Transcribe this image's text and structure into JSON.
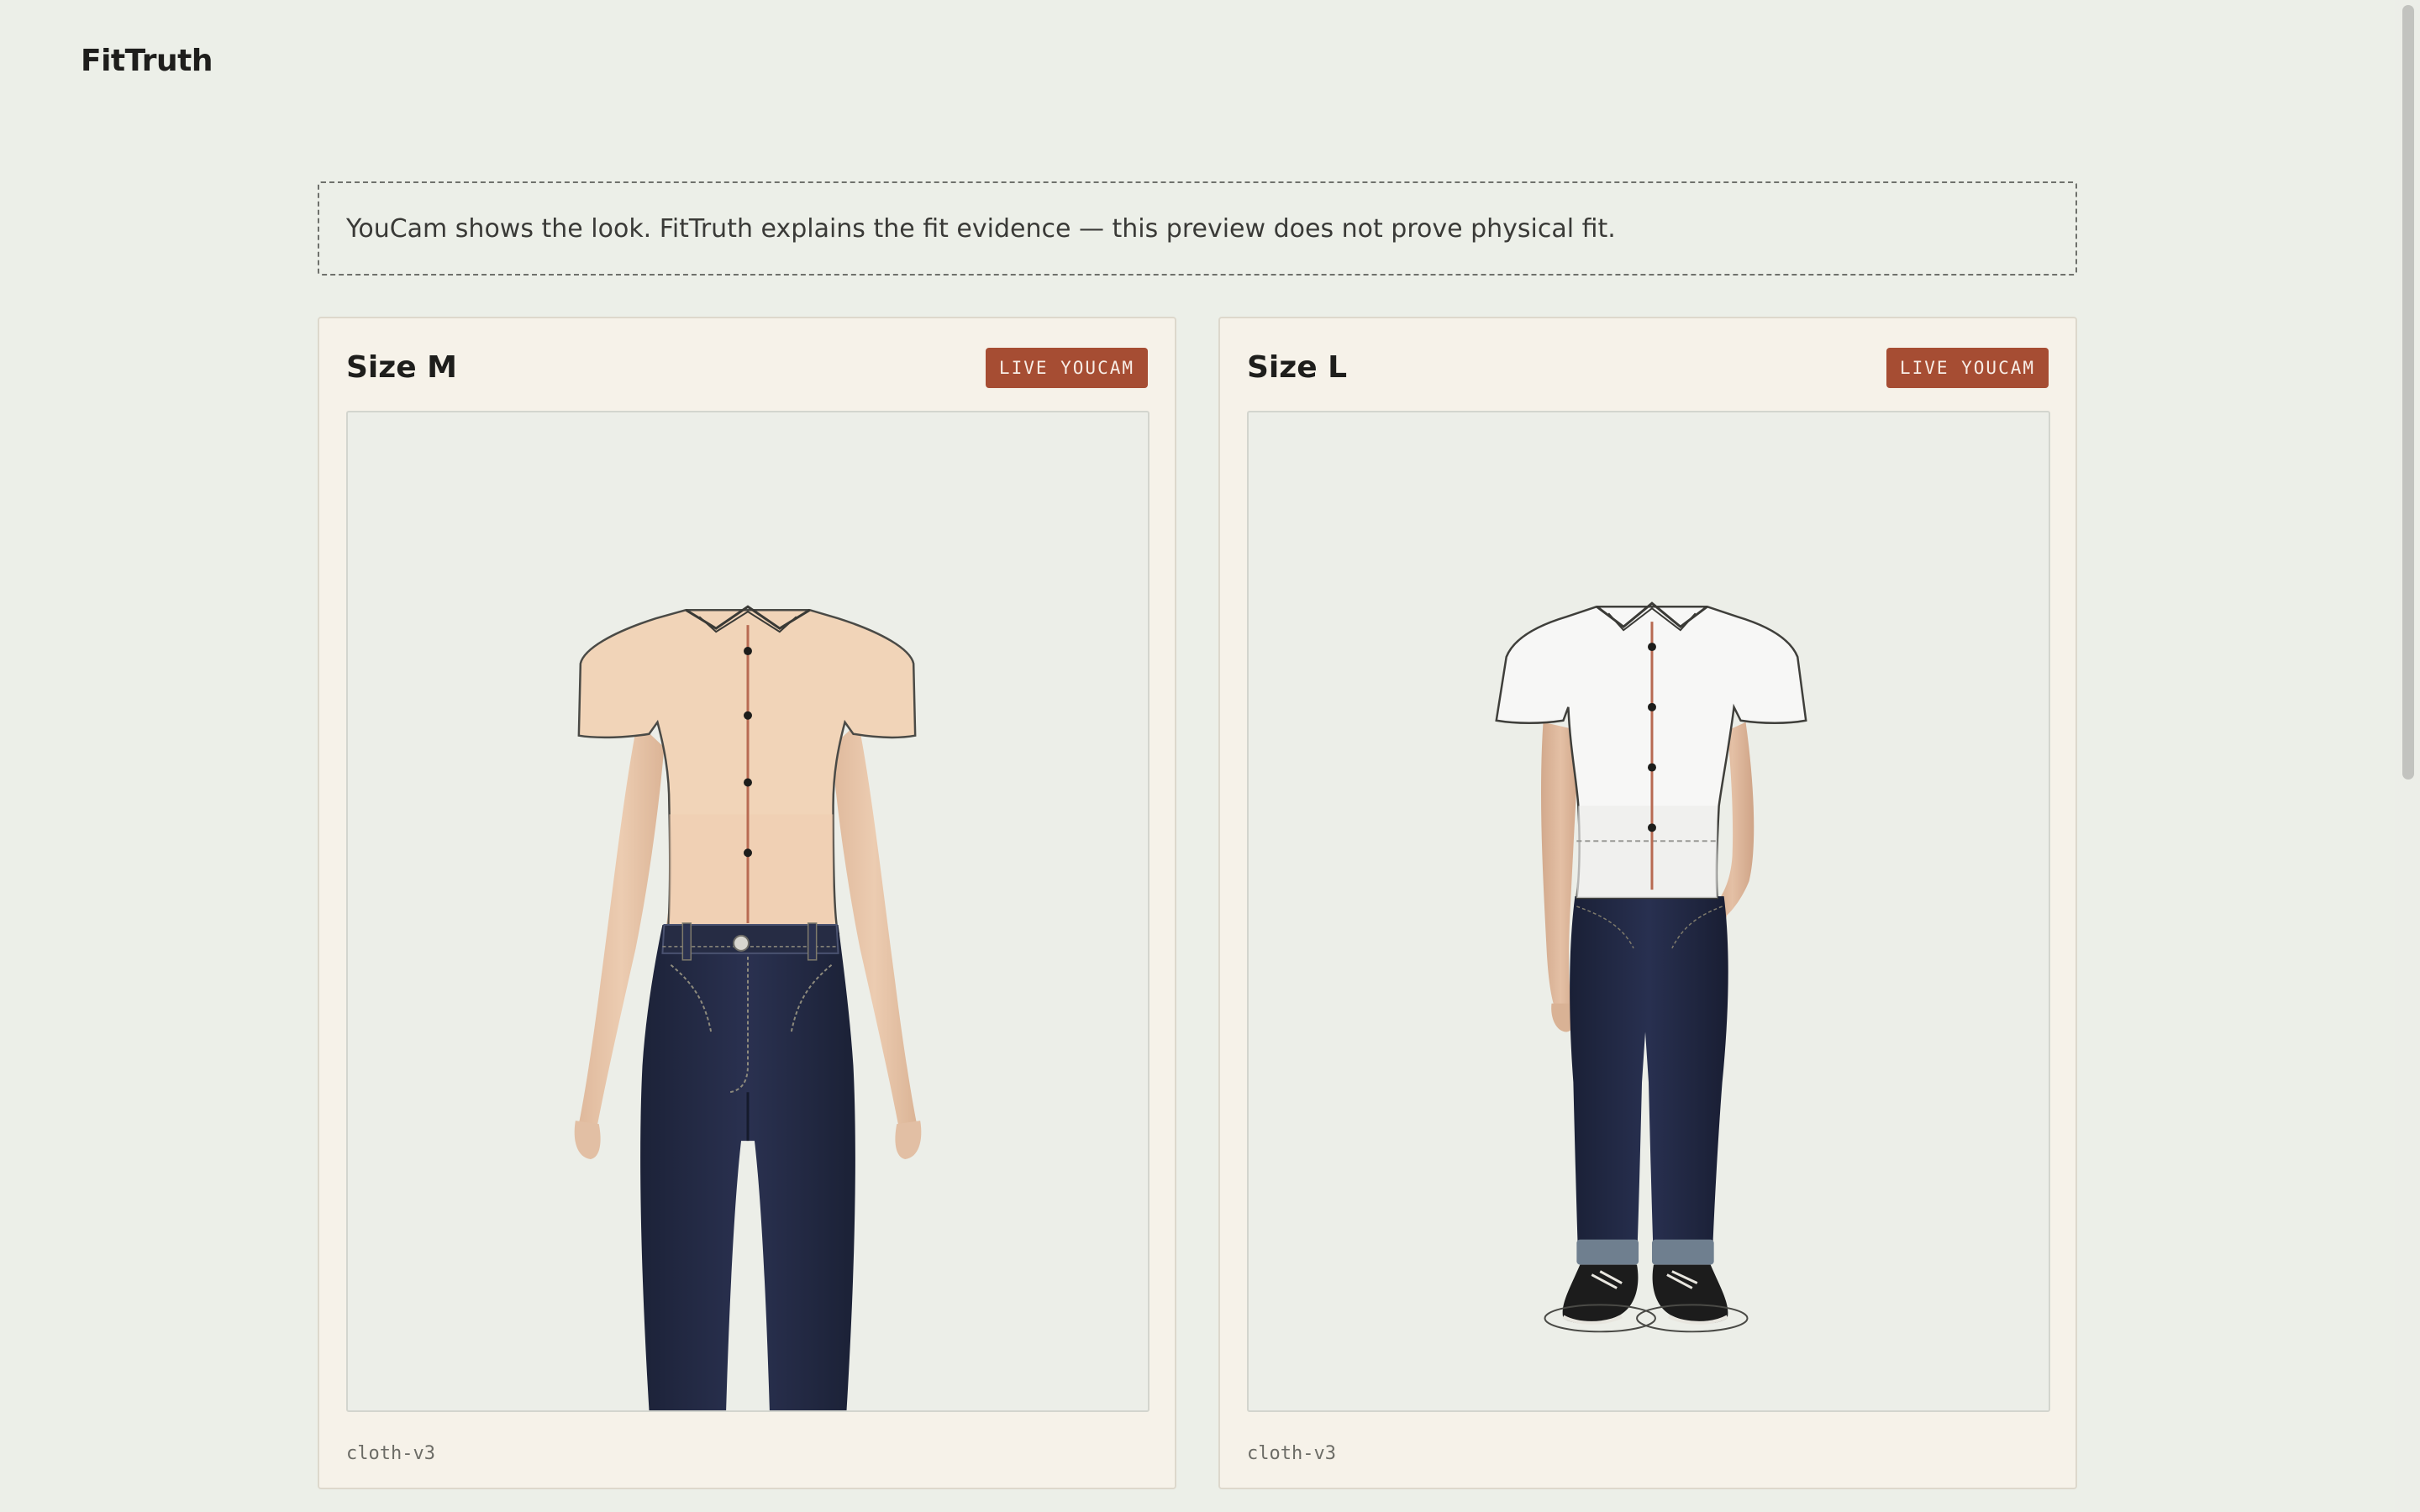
{
  "app": {
    "brand": "FitTruth"
  },
  "notice": {
    "text": "YouCam shows the look. FitTruth explains the fit evidence — this preview does not prove physical fit."
  },
  "cards": [
    {
      "title": "Size M",
      "badge": "LIVE YOUCAM",
      "caption": "cloth-v3"
    },
    {
      "title": "Size L",
      "badge": "LIVE YOUCAM",
      "caption": "cloth-v3"
    }
  ],
  "colors": {
    "accent": "#a64d33",
    "page_bg": "#ecefe8",
    "card_bg": "#f6f2e9",
    "shirt_m": "#f1d4b8",
    "shirt_l": "#f7f7f6",
    "denim": "#22283f",
    "skin": "#e8c7ac"
  }
}
